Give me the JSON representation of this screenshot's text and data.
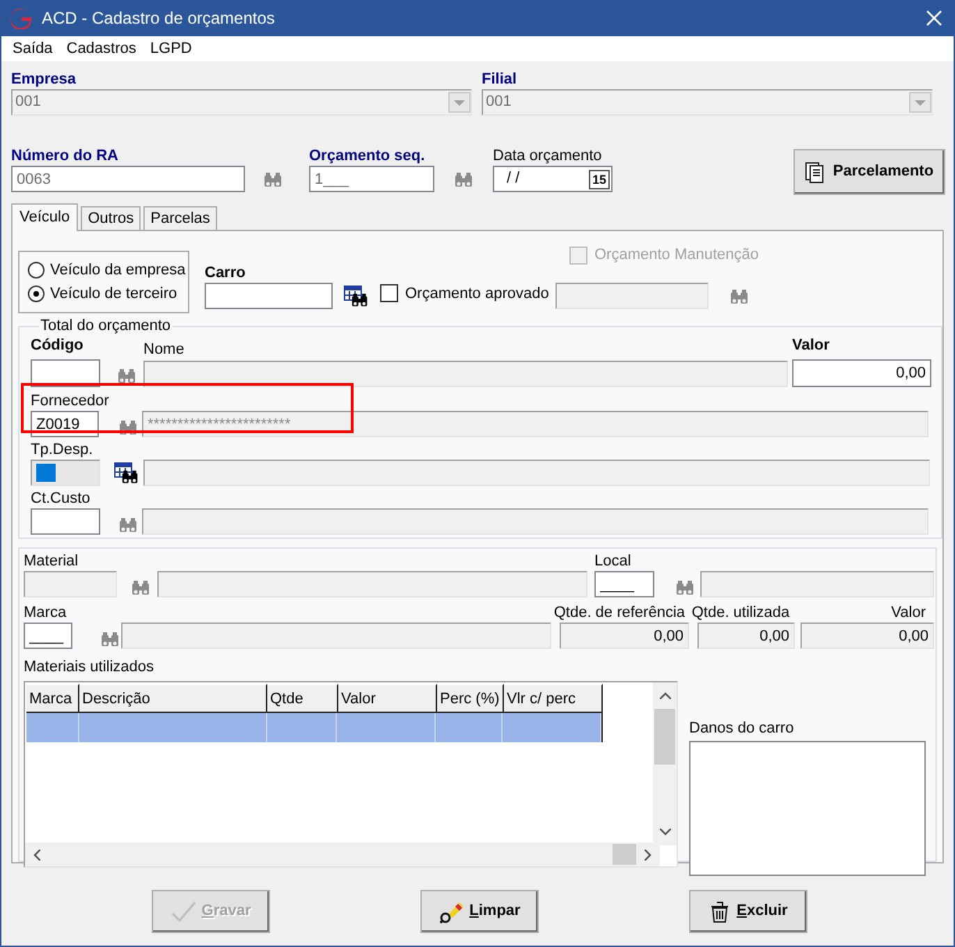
{
  "window": {
    "title": "ACD - Cadastro de orçamentos"
  },
  "menu": [
    {
      "label": "Saída"
    },
    {
      "label": "Cadastros"
    },
    {
      "label": "LGPD"
    }
  ],
  "empresa": {
    "label": "Empresa",
    "value": "001"
  },
  "filial": {
    "label": "Filial",
    "value": "001"
  },
  "numero_ra": {
    "label": "Número do RA",
    "value": "0063"
  },
  "orcamento_seq": {
    "label": "Orçamento seq.",
    "value": "1___"
  },
  "data_orcamento": {
    "label": "Data orçamento",
    "value": " / /",
    "calendar": "15"
  },
  "parcelamento_button": {
    "label": "Parcelamento"
  },
  "tabs": [
    {
      "label": "Veículo",
      "selected": true
    },
    {
      "label": "Outros",
      "selected": false
    },
    {
      "label": "Parcelas",
      "selected": false
    }
  ],
  "vehicle_options": [
    {
      "label": "Veículo da empresa",
      "selected": false
    },
    {
      "label": "Veículo de terceiro",
      "selected": true
    }
  ],
  "orcamento_manutencao": {
    "label": "Orçamento Manutenção",
    "checked": false,
    "disabled": true
  },
  "carro": {
    "label": "Carro"
  },
  "orcamento_aprovado": {
    "label": "Orçamento aprovado",
    "checked": false
  },
  "total_group": {
    "title": "Total do orçamento",
    "codigo_label": "Código",
    "nome_label": "Nome",
    "valor_label": "Valor",
    "valor": "0,00"
  },
  "fornecedor": {
    "label": "Fornecedor",
    "code": "Z0019",
    "name": "************************",
    "highlighted": true
  },
  "tp_desp": {
    "label": "Tp.Desp."
  },
  "ct_custo": {
    "label": "Ct.Custo"
  },
  "material": {
    "label": "Material",
    "local_label": "Local",
    "local_value": "____"
  },
  "marca": {
    "label": "Marca",
    "value": "____",
    "qtde_ref_label": "Qtde. de referência",
    "qtde_ref": "0,00",
    "qtde_util_label": "Qtde. utilizada",
    "qtde_util": "0,00",
    "valor_label": "Valor",
    "valor": "0,00"
  },
  "materiais": {
    "label": "Materiais utilizados",
    "columns": [
      "Marca",
      "Descrição",
      "Qtde",
      "Valor",
      "Perc (%)",
      "Vlr c/ perc"
    ],
    "rows": [
      {
        "selected": true
      }
    ]
  },
  "danos": {
    "label": "Danos do carro"
  },
  "buttons": [
    {
      "label": "Gravar",
      "kind": "save",
      "disabled": true
    },
    {
      "label": "Limpar",
      "kind": "clear",
      "disabled": false
    },
    {
      "label": "Excluir",
      "kind": "delete",
      "disabled": false
    }
  ]
}
